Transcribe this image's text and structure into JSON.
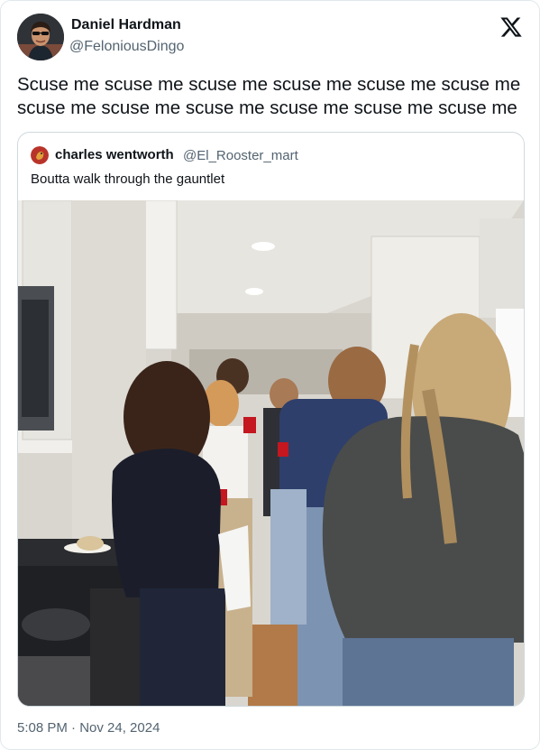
{
  "author": {
    "name": "Daniel Hardman",
    "handle": "@FeloniousDingo"
  },
  "tweet": {
    "text": "Scuse me scuse me scuse me scuse me scuse me scuse me scuse me scuse me scuse me scuse me scuse me scuse me"
  },
  "quoted": {
    "name": "charles wentworth",
    "handle": "@El_Rooster_mart",
    "text": "Boutta walk through the gauntlet"
  },
  "footer": {
    "timestamp": "5:08 PM · Nov 24, 2024"
  },
  "icons": {
    "brand": "x-logo-icon"
  },
  "colors": {
    "text": "#0f1419",
    "secondary": "#536471",
    "border": "#cfd9de"
  }
}
